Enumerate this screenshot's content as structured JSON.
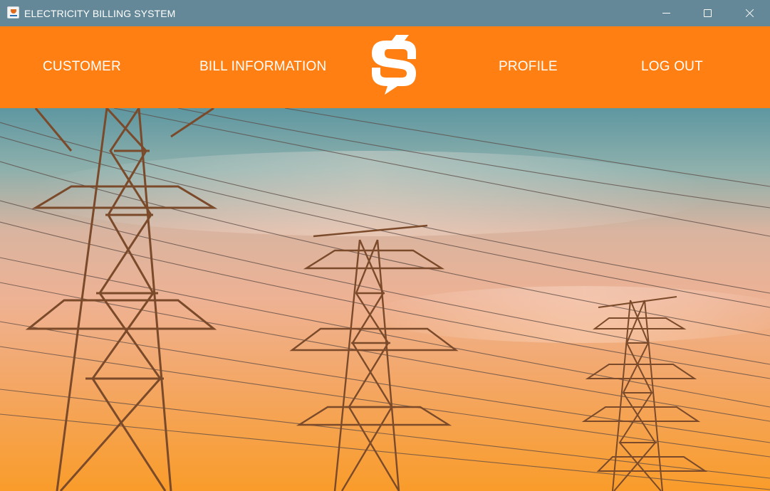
{
  "window": {
    "title": "ELECTRICITY BILLING SYSTEM",
    "app_icon": "java-cup-icon"
  },
  "controls": {
    "minimize_icon": "minimize-icon",
    "maximize_icon": "maximize-icon",
    "close_icon": "close-icon"
  },
  "nav": {
    "customer": "CUSTOMER",
    "bill_information": "BILL INFORMATION",
    "profile": "PROFILE",
    "logout": "LOG OUT",
    "logo_icon": "lightning-bolt-logo-icon"
  },
  "colors": {
    "titlebar": "#648897",
    "navbar": "#ff7f12",
    "nav_text": "#ffffff"
  },
  "background": {
    "subject": "electricity-transmission-towers-photo"
  }
}
